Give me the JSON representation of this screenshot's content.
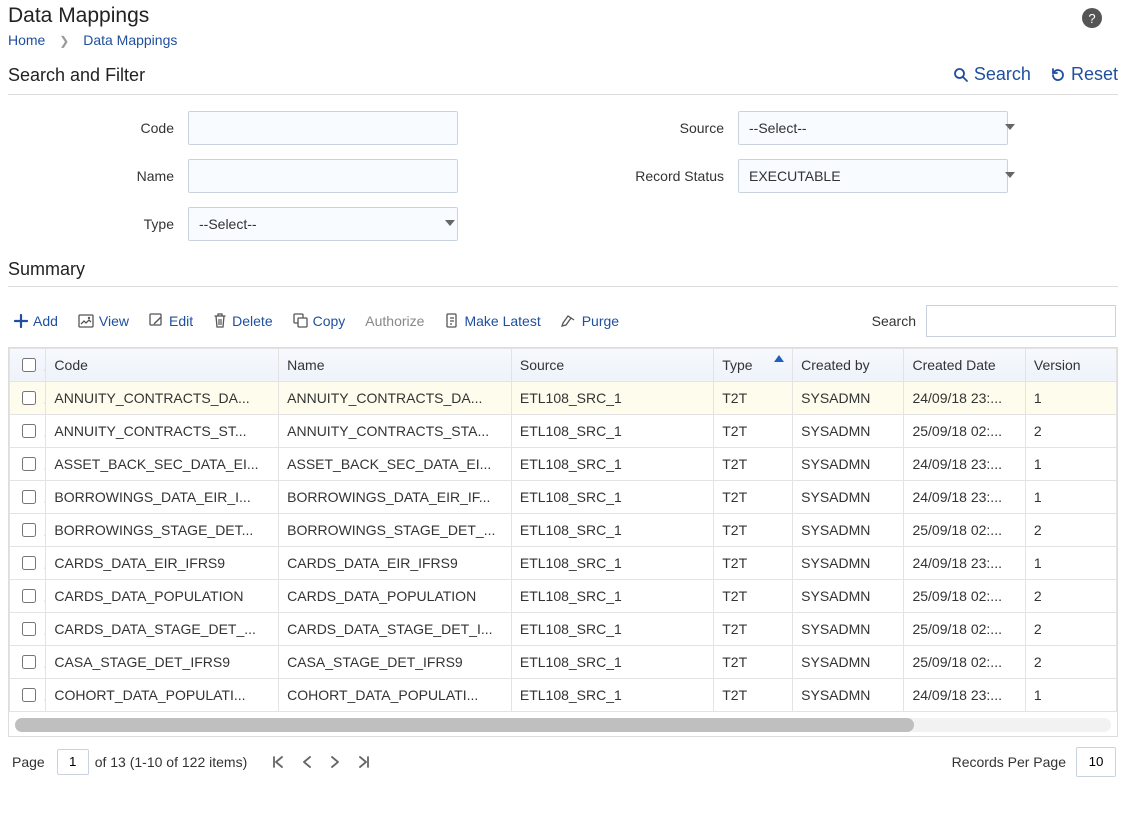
{
  "header": {
    "title": "Data Mappings",
    "breadcrumb_home": "Home",
    "breadcrumb_current": "Data Mappings",
    "help_glyph": "?"
  },
  "search_filter": {
    "title": "Search and Filter",
    "search_label": "Search",
    "reset_label": "Reset",
    "fields": {
      "code_label": "Code",
      "code_value": "",
      "name_label": "Name",
      "name_value": "",
      "type_label": "Type",
      "type_selected": "--Select--",
      "source_label": "Source",
      "source_selected": "--Select--",
      "record_status_label": "Record Status",
      "record_status_selected": "EXECUTABLE"
    }
  },
  "summary": {
    "title": "Summary",
    "toolbar": {
      "add": "Add",
      "view": "View",
      "edit": "Edit",
      "delete": "Delete",
      "copy": "Copy",
      "authorize": "Authorize",
      "make_latest": "Make Latest",
      "purge": "Purge",
      "search_label": "Search",
      "search_value": ""
    },
    "columns": {
      "code": "Code",
      "name": "Name",
      "source": "Source",
      "type": "Type",
      "created_by": "Created by",
      "created_date": "Created Date",
      "version": "Version"
    },
    "rows": [
      {
        "code": "ANNUITY_CONTRACTS_DA...",
        "name": "ANNUITY_CONTRACTS_DA...",
        "source": "ETL108_SRC_1",
        "type": "T2T",
        "created_by": "SYSADMN",
        "created_date": "24/09/18 23:...",
        "version": "1"
      },
      {
        "code": "ANNUITY_CONTRACTS_ST...",
        "name": "ANNUITY_CONTRACTS_STA...",
        "source": "ETL108_SRC_1",
        "type": "T2T",
        "created_by": "SYSADMN",
        "created_date": "25/09/18 02:...",
        "version": "2"
      },
      {
        "code": "ASSET_BACK_SEC_DATA_EI...",
        "name": "ASSET_BACK_SEC_DATA_EI...",
        "source": "ETL108_SRC_1",
        "type": "T2T",
        "created_by": "SYSADMN",
        "created_date": "24/09/18 23:...",
        "version": "1"
      },
      {
        "code": "BORROWINGS_DATA_EIR_I...",
        "name": "BORROWINGS_DATA_EIR_IF...",
        "source": "ETL108_SRC_1",
        "type": "T2T",
        "created_by": "SYSADMN",
        "created_date": "24/09/18 23:...",
        "version": "1"
      },
      {
        "code": "BORROWINGS_STAGE_DET...",
        "name": "BORROWINGS_STAGE_DET_...",
        "source": "ETL108_SRC_1",
        "type": "T2T",
        "created_by": "SYSADMN",
        "created_date": "25/09/18 02:...",
        "version": "2"
      },
      {
        "code": "CARDS_DATA_EIR_IFRS9",
        "name": "CARDS_DATA_EIR_IFRS9",
        "source": "ETL108_SRC_1",
        "type": "T2T",
        "created_by": "SYSADMN",
        "created_date": "24/09/18 23:...",
        "version": "1"
      },
      {
        "code": "CARDS_DATA_POPULATION",
        "name": "CARDS_DATA_POPULATION",
        "source": "ETL108_SRC_1",
        "type": "T2T",
        "created_by": "SYSADMN",
        "created_date": "25/09/18 02:...",
        "version": "2"
      },
      {
        "code": "CARDS_DATA_STAGE_DET_...",
        "name": "CARDS_DATA_STAGE_DET_I...",
        "source": "ETL108_SRC_1",
        "type": "T2T",
        "created_by": "SYSADMN",
        "created_date": "25/09/18 02:...",
        "version": "2"
      },
      {
        "code": "CASA_STAGE_DET_IFRS9",
        "name": "CASA_STAGE_DET_IFRS9",
        "source": "ETL108_SRC_1",
        "type": "T2T",
        "created_by": "SYSADMN",
        "created_date": "25/09/18 02:...",
        "version": "2"
      },
      {
        "code": "COHORT_DATA_POPULATI...",
        "name": "COHORT_DATA_POPULATI...",
        "source": "ETL108_SRC_1",
        "type": "T2T",
        "created_by": "SYSADMN",
        "created_date": "24/09/18 23:...",
        "version": "1"
      }
    ],
    "pager": {
      "page_label": "Page",
      "page_value": "1",
      "info": "of 13 (1-10 of 122 items)",
      "rpp_label": "Records Per Page",
      "rpp_value": "10"
    }
  }
}
